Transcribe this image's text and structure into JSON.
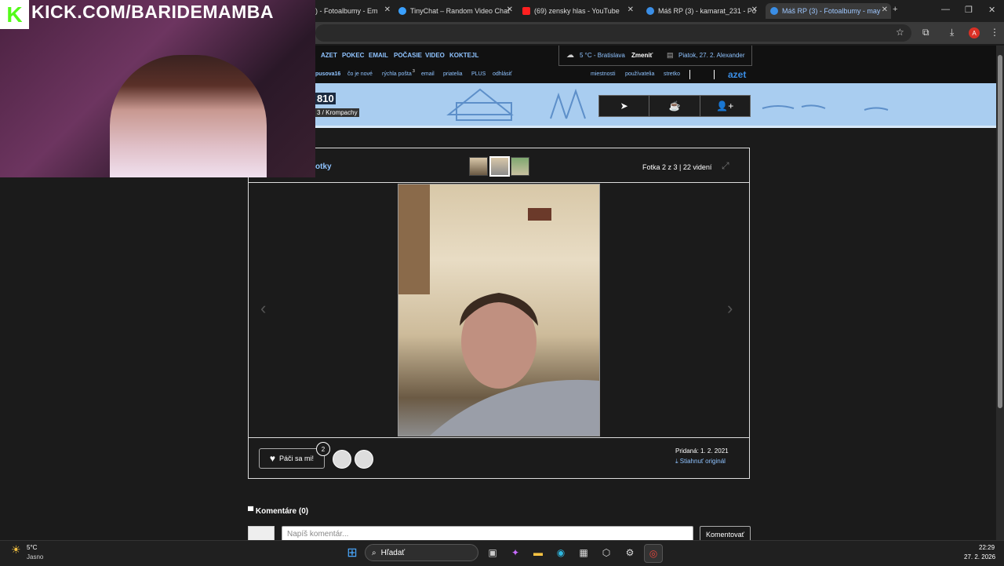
{
  "browser": {
    "tabs": [
      {
        "label": ") - Fotoalbumy - Em"
      },
      {
        "label": "TinyChat – Random Video Chat"
      },
      {
        "label": "(69) zensky hlas - YouTube"
      },
      {
        "label": "Máš RP (3) - kamarat_231 - Po"
      },
      {
        "label": "Máš RP (3) - Fotoalbumy - may"
      }
    ],
    "new_tab": "+",
    "profile_initial": "A"
  },
  "site": {
    "topnav": [
      "AZET",
      "POKEC",
      "EMAIL",
      "POČASIE",
      "VIDEO",
      "KOKTEJL"
    ],
    "weather": "5 °C - Bratislava",
    "change": "Zmeniť",
    "date": "Piatok, 27. 2. Alexander",
    "subnav": {
      "user": "pusova16",
      "whats_new": "čo je nové",
      "quick_mail": "rýchla pošta",
      "quick_mail_count": "3",
      "email": "email",
      "friends": "priatelia",
      "plus": "PLUS",
      "logout": "odhlásiť",
      "rooms": "miestnosti",
      "users": "používatelia",
      "meetings": "stretko",
      "brand": "azet"
    },
    "banner": {
      "number": "810",
      "location": "3 / Krompachy"
    }
  },
  "gallery": {
    "title": "otky",
    "counter": "Fotka 2 z 3 | 22 videní",
    "like_label": "Páči sa mi!",
    "like_count": "2",
    "added": "Pridaná: 1. 2. 2021",
    "download": "Stiahnuť originál"
  },
  "comments": {
    "heading": "Komentáre (0)",
    "placeholder": "Napíš komentár...",
    "submit": "Komentovať"
  },
  "stream": {
    "url": "KICK.COM/BARIDEMAMBA",
    "logo": "K"
  },
  "taskbar": {
    "temp": "5°C",
    "weather": "Jasno",
    "search": "Hľadať",
    "time": "22:29",
    "date": "27. 2. 2026"
  },
  "colors": {
    "accent": "#8fc3ff",
    "kick_green": "#53fc18",
    "banner": "#a9cdf0"
  }
}
